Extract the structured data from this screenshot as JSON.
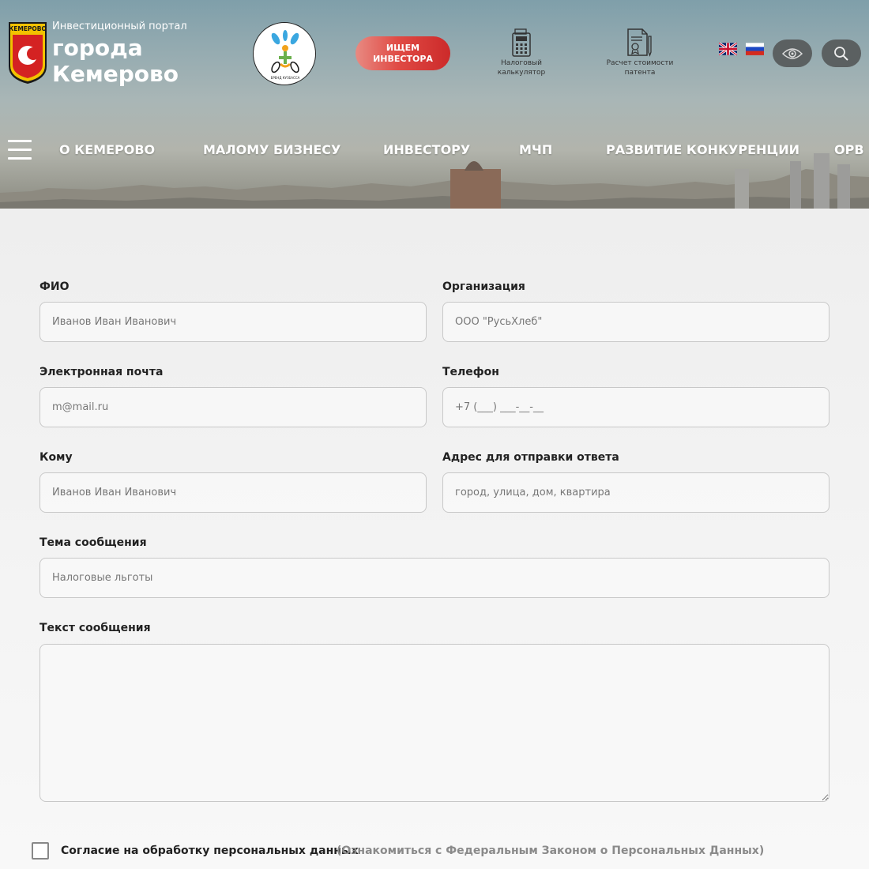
{
  "header": {
    "portal_subtitle": "Инвестиционный портал",
    "portal_title_line1": "города",
    "portal_title_line2": "Кемерово",
    "emblem_text": "КЕМЕРОВО",
    "brand_circle_text": "БРЕНД КУЗБАССА",
    "invest_button_line1": "ИЩЕМ",
    "invest_button_line2": "ИНВЕСТОРА",
    "tax_calc_line1": "Налоговый",
    "tax_calc_line2": "калькулятор",
    "patent_calc_line1": "Расчет стоимости",
    "patent_calc_line2": "патента",
    "lang_en_icon": "uk-flag-icon",
    "lang_ru_icon": "ru-flag-icon",
    "accessibility_icon": "eye-icon",
    "search_icon": "search-icon"
  },
  "nav": {
    "menu_icon": "hamburger-icon",
    "items": [
      {
        "label": "О КЕМЕРОВО"
      },
      {
        "label": "МАЛОМУ БИЗНЕСУ"
      },
      {
        "label": "ИНВЕСТОРУ"
      },
      {
        "label": "МЧП"
      },
      {
        "label": "РАЗВИТИЕ КОНКУРЕНЦИИ"
      },
      {
        "label": "ОРВ"
      }
    ]
  },
  "form": {
    "fio": {
      "label": "ФИО",
      "placeholder": "Иванов Иван Иванович"
    },
    "organization": {
      "label": "Организация",
      "placeholder": "ООО \"РусьХлеб\""
    },
    "email": {
      "label": "Электронная почта",
      "placeholder": "m@mail.ru"
    },
    "phone": {
      "label": "Телефон",
      "placeholder": "+7 (___) ___-__-__"
    },
    "to": {
      "label": "Кому",
      "placeholder": "Иванов Иван Иванович"
    },
    "address": {
      "label": "Адрес для отправки ответа",
      "placeholder": "город, улица, дом, квартира"
    },
    "subject": {
      "label": "Тема сообщения",
      "placeholder": "Налоговые льготы"
    },
    "message": {
      "label": "Текст сообщения",
      "placeholder": ""
    },
    "consent_label": "Согласие на обработку персональных данных",
    "consent_link": "(Ознакомиться с Федеральным Законом о Персональных Данных)"
  },
  "colors": {
    "invest_button": "#e04a44",
    "round_button": "#5b6061",
    "field_border": "#c8c8c8"
  }
}
